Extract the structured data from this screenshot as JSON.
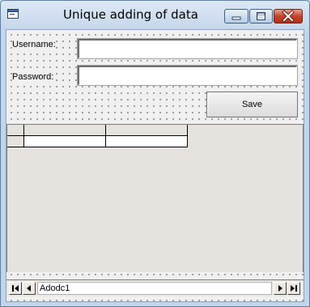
{
  "window": {
    "title": "Unique adding of data",
    "icon": "form-icon",
    "controls": [
      "minimize-icon",
      "maximize-icon",
      "close-icon"
    ]
  },
  "form": {
    "username_label": "Username:",
    "username_value": "",
    "password_label": "Password:",
    "password_value": "",
    "save_label": "Save"
  },
  "grid": {
    "columns": [
      "",
      ""
    ],
    "rows": [
      [
        "",
        ""
      ]
    ]
  },
  "adodc": {
    "caption": "Adodc1",
    "buttons": [
      "first-record-icon",
      "prev-record-icon",
      "next-record-icon",
      "last-record-icon"
    ]
  },
  "colors": {
    "title_bar": "#c3d5ea",
    "close_button": "#c5432c",
    "form_background": "#f0f0f0"
  }
}
